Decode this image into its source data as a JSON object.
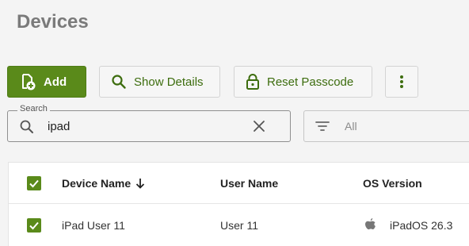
{
  "page": {
    "title": "Devices"
  },
  "toolbar": {
    "add_label": "Add",
    "show_details_label": "Show Details",
    "reset_passcode_label": "Reset Passcode"
  },
  "search": {
    "label": "Search",
    "value": "ipad"
  },
  "filter": {
    "value": "All"
  },
  "table": {
    "columns": [
      "Device Name",
      "User Name",
      "OS Version"
    ],
    "sort_column": "Device Name",
    "sort_direction": "descending",
    "rows": [
      {
        "selected": true,
        "device_name": "iPad User 11",
        "user_name": "User 11",
        "os_icon": "apple-icon",
        "os_version": "iPadOS 26.3"
      }
    ]
  },
  "colors": {
    "accent": "#5a8a1a",
    "accent_text": "#3d6d0e",
    "title_gray": "#7a7a7a"
  }
}
